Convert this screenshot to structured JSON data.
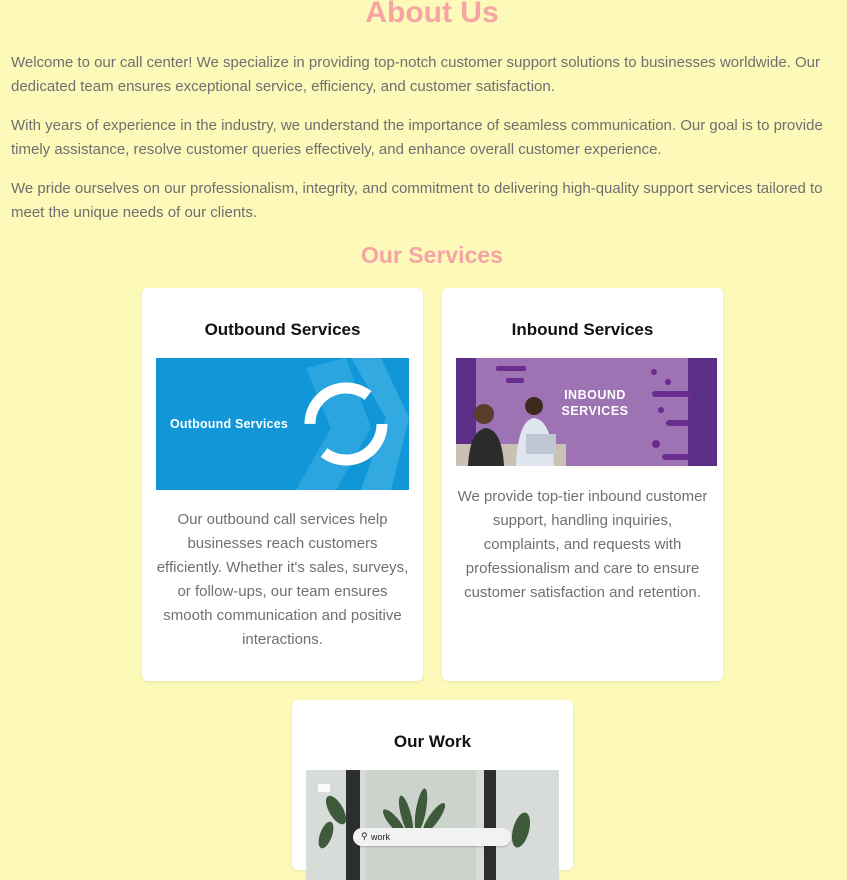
{
  "about": {
    "title": "About Us",
    "paragraphs": [
      "Welcome to our call center! We specialize in providing top-notch customer support solutions to businesses worldwide. Our dedicated team ensures exceptional service, efficiency, and customer satisfaction.",
      "With years of experience in the industry, we understand the importance of seamless communication. Our goal is to provide timely assistance, resolve customer queries effectively, and enhance overall customer experience.",
      "We pride ourselves on our professionalism, integrity, and commitment to delivering high-quality support services tailored to meet the unique needs of our clients."
    ]
  },
  "services": {
    "title": "Our Services",
    "cards": [
      {
        "title": "Outbound Services",
        "image_label": "Outbound Services",
        "description": "Our outbound call services help businesses reach customers efficiently. Whether it's sales, surveys, or follow-ups, our team ensures smooth communication and positive interactions."
      },
      {
        "title": "Inbound Services",
        "image_label": "INBOUND SERVICES",
        "description": "We provide top-tier inbound customer support, handling inquiries, complaints, and requests with professionalism and care to ensure customer satisfaction and retention."
      }
    ]
  },
  "work": {
    "title": "Our Work",
    "search_text": "work"
  },
  "colors": {
    "background": "#fdf9b9",
    "heading_pink": "#f6a5a5",
    "outbound_blue": "#1196d8",
    "inbound_purple": "#9d73b4"
  }
}
